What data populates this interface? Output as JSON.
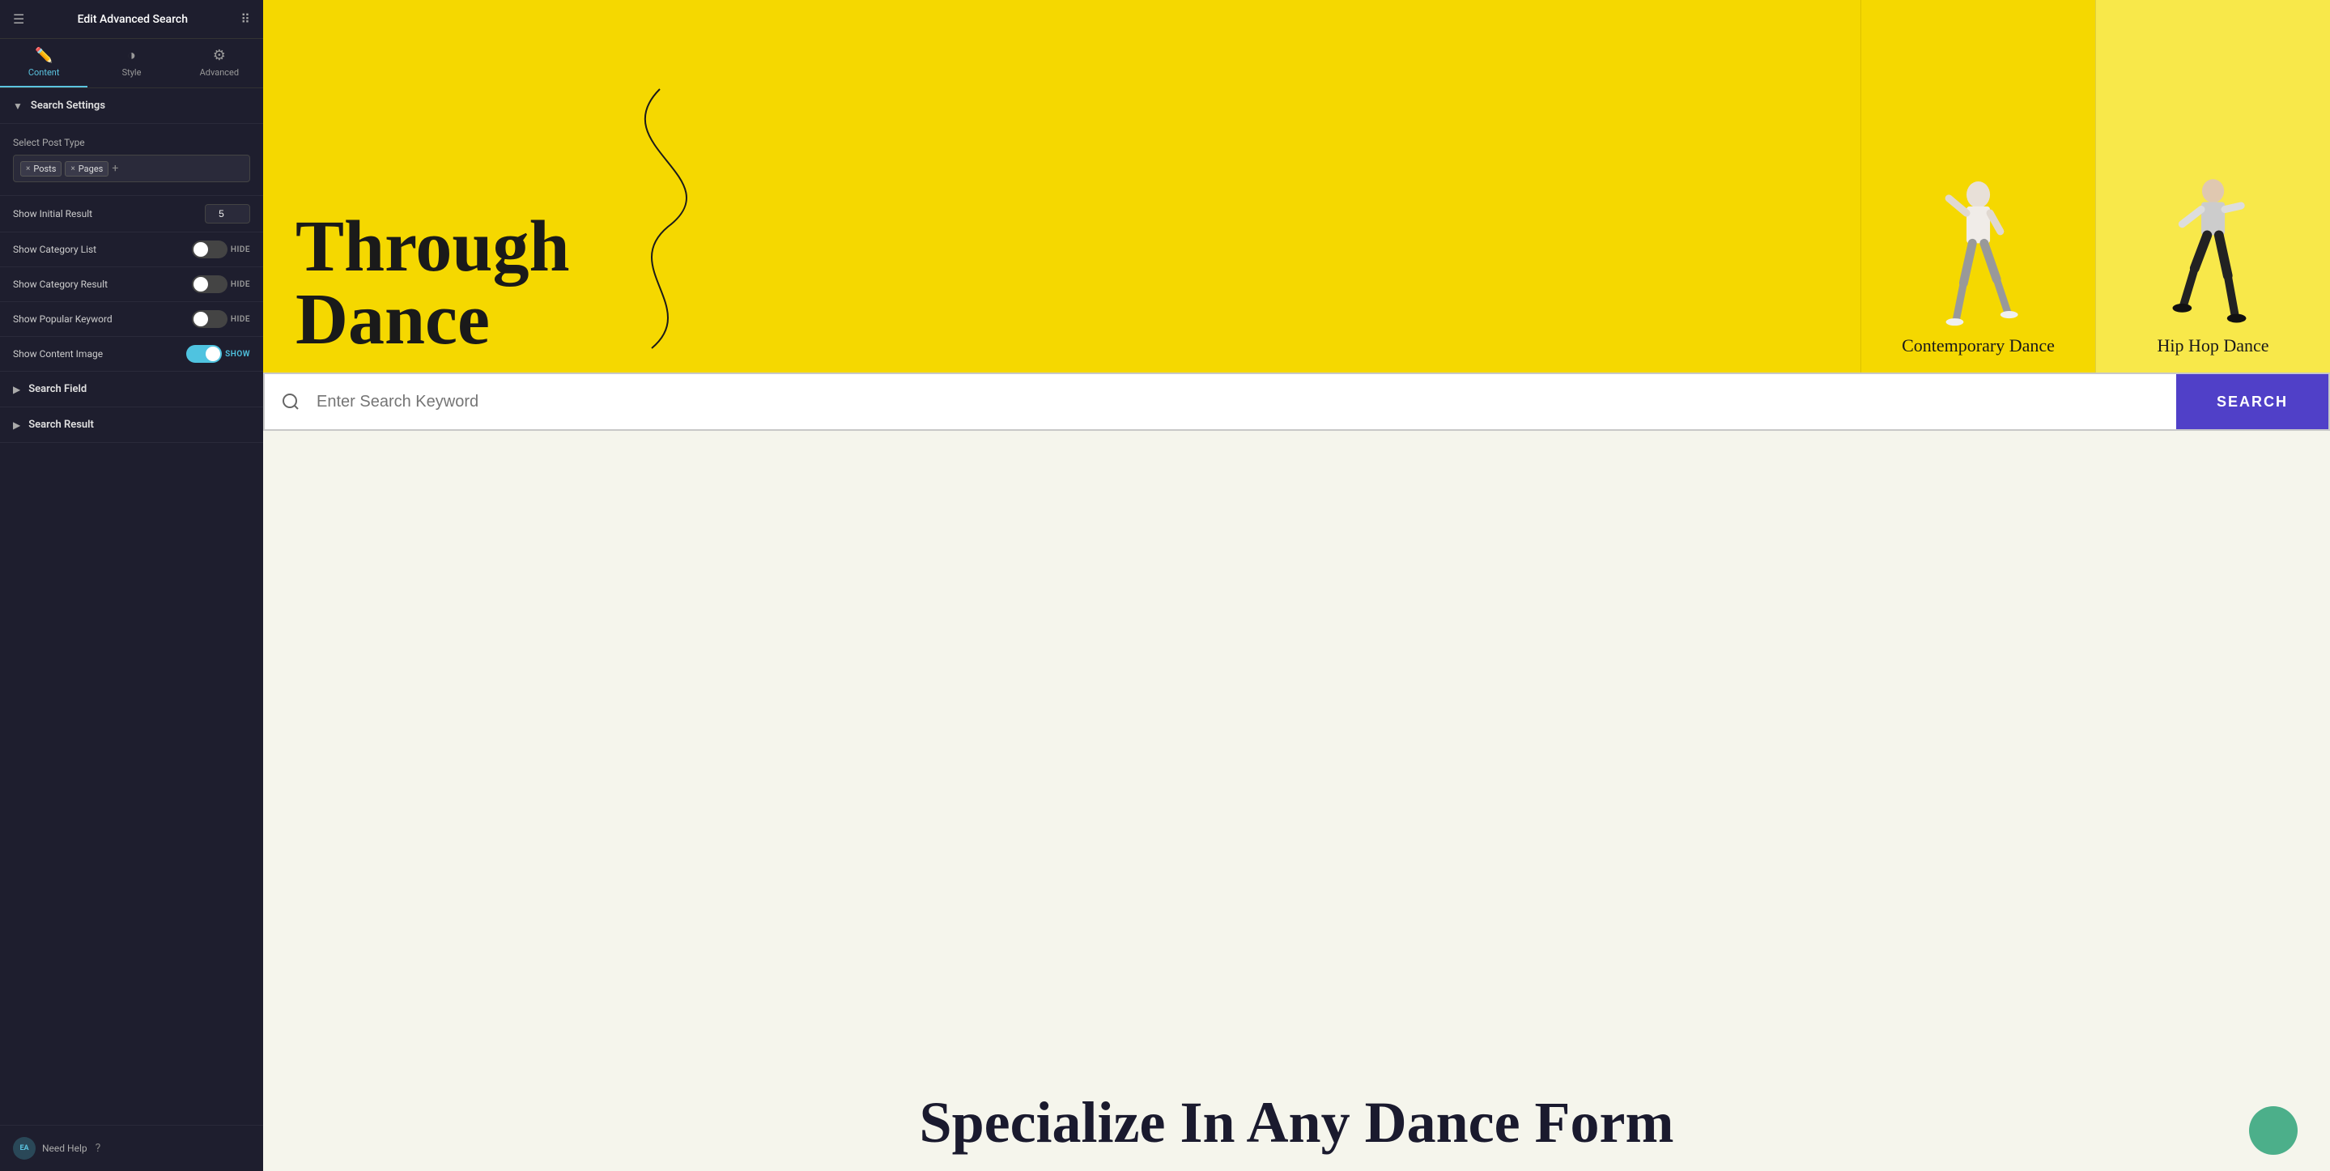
{
  "sidebar": {
    "header": {
      "title": "Edit Advanced Search"
    },
    "tabs": [
      {
        "id": "content",
        "label": "Content",
        "icon": "✏️",
        "active": true
      },
      {
        "id": "style",
        "label": "Style",
        "icon": "◑",
        "active": false
      },
      {
        "id": "advanced",
        "label": "Advanced",
        "icon": "⚙",
        "active": false
      }
    ],
    "sections": {
      "search_settings": {
        "label": "Search Settings",
        "expanded": true,
        "select_post_type_label": "Select Post Type",
        "tags": [
          "Posts",
          "Pages"
        ],
        "show_initial_result": {
          "label": "Show Initial Result",
          "value": "5"
        },
        "show_category_list": {
          "label": "Show Category List",
          "toggle_state": false,
          "toggle_off_label": "HIDE"
        },
        "show_category_result": {
          "label": "Show Category Result",
          "toggle_state": false,
          "toggle_off_label": "HIDE"
        },
        "show_popular_keyword": {
          "label": "Show Popular Keyword",
          "toggle_state": false,
          "toggle_off_label": "HIDE"
        },
        "show_content_image": {
          "label": "Show Content Image",
          "toggle_state": true,
          "toggle_on_label": "SHOW"
        }
      },
      "search_field": {
        "label": "Search Field",
        "expanded": false
      },
      "search_result": {
        "label": "Search Result",
        "expanded": false
      }
    },
    "footer": {
      "badge": "EA",
      "help_text": "Need Help"
    }
  },
  "main": {
    "hero": {
      "title_line1": "Through",
      "title_line2": "Dance"
    },
    "cards": [
      {
        "id": "contemporary",
        "label": "Contemporary Dance"
      },
      {
        "id": "hiphop",
        "label": "Hip Hop Dance"
      }
    ],
    "search_bar": {
      "placeholder": "Enter Search Keyword",
      "button_label": "SEARCH"
    },
    "bottom": {
      "title": "Specialize In Any Dance Form"
    }
  }
}
